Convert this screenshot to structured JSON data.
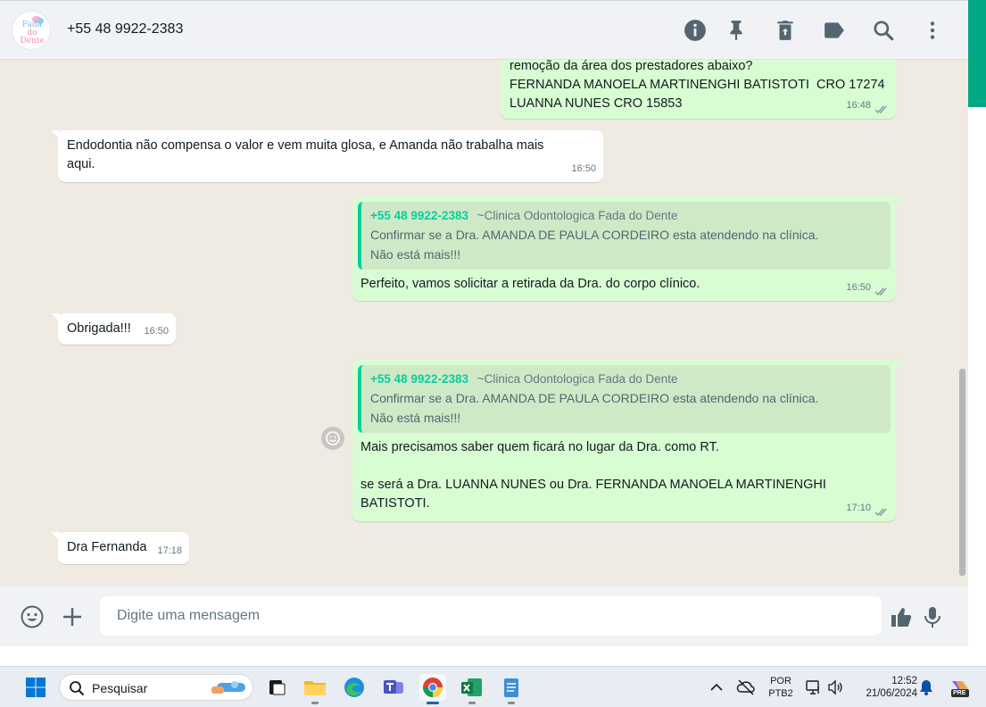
{
  "header": {
    "avatar_logo_line1": "Fada",
    "avatar_logo_line2": "do Dente",
    "contact": "+55 48 9922-2383",
    "icons": [
      "info-icon",
      "pin-icon",
      "delete-icon",
      "label-icon",
      "search-icon",
      "menu-icon"
    ]
  },
  "messages": {
    "m1": {
      "text": "remoção da área dos prestadores abaixo?\nFERNANDA MANOELA MARTINENGHI BATISTOTI  CRO 17274\nLUANNA NUNES CRO 15853",
      "time": "16:48"
    },
    "m2": {
      "text": "Endodontia não compensa o valor e vem muita glosa, e Amanda não trabalha mais\naqui.",
      "time": "16:50"
    },
    "m3": {
      "quote_number": "+55 48 9922-2383",
      "quote_name": "~Clinica Odontologica Fada do Dente",
      "quote_text": "Confirmar se a Dra. AMANDA DE PAULA CORDEIRO esta atendendo na clínica.\nNão está mais!!!",
      "text": "Perfeito, vamos solicitar a retirada da Dra. do corpo clínico.",
      "time": "16:50"
    },
    "m4": {
      "text": "Obrigada!!!",
      "time": "16:50"
    },
    "m5": {
      "quote_number": "+55 48 9922-2383",
      "quote_name": "~Clinica Odontologica Fada do Dente",
      "quote_text": "Confirmar se a Dra. AMANDA DE PAULA CORDEIRO esta atendendo na clínica.\nNão está mais!!!",
      "text": "Mais precisamos saber quem ficará no lugar da Dra. como RT.\n\nse será a Dra. LUANNA NUNES ou Dra. FERNANDA MANOELA MARTINENGHI\nBATISTOTI.",
      "time": "17:10"
    },
    "m6": {
      "text": "Dra Fernanda",
      "time": "17:18"
    }
  },
  "footer": {
    "placeholder": "Digite uma mensagem"
  },
  "taskbar": {
    "search_label": "Pesquisar",
    "lang_line1": "POR",
    "lang_line2": "PTB2",
    "time": "12:52",
    "date": "21/06/2024",
    "copilot_badge": "PRE"
  },
  "colors": {
    "accent": "#00a884",
    "outgoing_bubble": "#d9fdd3",
    "incoming_bubble": "#ffffff",
    "chat_background": "#efeae2",
    "quote_bar": "#06cf9c",
    "read_ticks": "#53bdeb"
  }
}
